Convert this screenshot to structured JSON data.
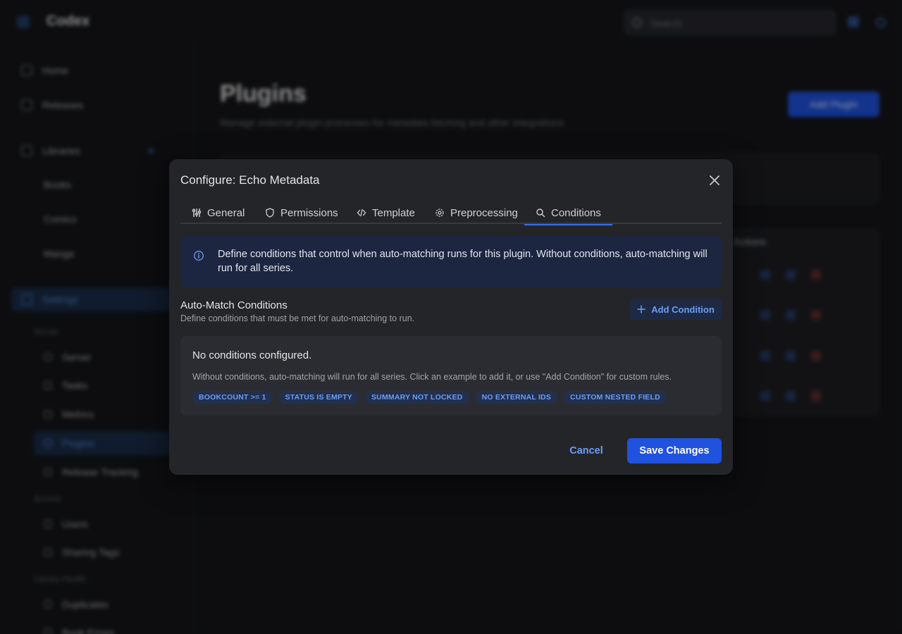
{
  "app": {
    "name": "Codex"
  },
  "header": {
    "search_placeholder": "Search"
  },
  "sidebar": {
    "items": [
      {
        "label": "Home"
      },
      {
        "label": "Releases"
      },
      {
        "label": "Libraries"
      },
      {
        "label": "Books"
      },
      {
        "label": "Comics"
      },
      {
        "label": "Manga"
      },
      {
        "label": "Settings"
      }
    ],
    "sections": [
      {
        "title": "Server",
        "items": [
          {
            "label": "Server"
          },
          {
            "label": "Tasks"
          },
          {
            "label": "Metrics"
          },
          {
            "label": "Plugins"
          },
          {
            "label": "Release Tracking"
          }
        ]
      },
      {
        "title": "Access",
        "items": [
          {
            "label": "Users"
          },
          {
            "label": "Sharing Tags"
          }
        ]
      },
      {
        "title": "Library Health",
        "items": [
          {
            "label": "Duplicates"
          },
          {
            "label": "Book Errors"
          }
        ]
      }
    ]
  },
  "page": {
    "title": "Plugins",
    "subtitle": "Manage external plugin processes for metadata fetching and other integrations",
    "add_button": "Add Plugin",
    "column_header": "Actions"
  },
  "modal": {
    "title": "Configure: Echo Metadata",
    "tabs": [
      {
        "label": "General",
        "icon": "sliders-icon"
      },
      {
        "label": "Permissions",
        "icon": "shield-icon"
      },
      {
        "label": "Template",
        "icon": "code-icon"
      },
      {
        "label": "Preprocessing",
        "icon": "gear-icon"
      },
      {
        "label": "Conditions",
        "icon": "search-icon",
        "active": true
      }
    ],
    "info": "Define conditions that control when auto-matching runs for this plugin. Without conditions, auto-matching will run for all series.",
    "section_title": "Auto-Match Conditions",
    "section_subtitle": "Define conditions that must be met for auto-matching to run.",
    "add_condition": "Add Condition",
    "empty_title": "No conditions configured.",
    "empty_desc": "Without conditions, auto-matching will run for all series. Click an example to add it, or use \"Add Condition\" for custom rules.",
    "examples": [
      "BOOKCOUNT >= 1",
      "STATUS IS EMPTY",
      "SUMMARY NOT LOCKED",
      "NO EXTERNAL IDS",
      "CUSTOM NESTED FIELD"
    ],
    "cancel": "Cancel",
    "save": "Save Changes"
  },
  "colors": {
    "accent": "#1f52de",
    "accent_text": "#6d9df5",
    "modal_bg": "#242529",
    "info_bg": "#1d2640"
  }
}
